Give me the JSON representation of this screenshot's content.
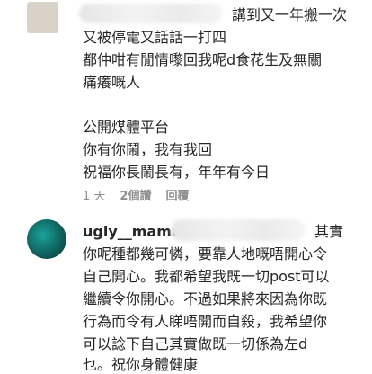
{
  "comment1": {
    "lines": [
      "講到又一年搬一次",
      "又被停電又話話一打四",
      "都仲咁有閒情嚟回我呢d食花生及無關",
      "痛癢嘅人",
      "",
      "公開煤體平台",
      "你有你鬧，我有我回",
      "祝福你長鬧長有，年年有今日"
    ],
    "meta": {
      "time": "1 天",
      "likes": "2個讚",
      "reply": "回覆"
    }
  },
  "comment2": {
    "username": "ugly__mama",
    "lines": [
      "其實",
      "你呢種都幾可憐，要靠人地嘅唔開心令",
      "自己開心。我都希望我既一切post可以",
      "繼續令你開心。不過如果將來因為你既",
      "行為而令有人睇唔開而自殺，我希望你",
      "可以諗下自己其實做既一切係為左d",
      "乜。祝你身體健康"
    ]
  }
}
